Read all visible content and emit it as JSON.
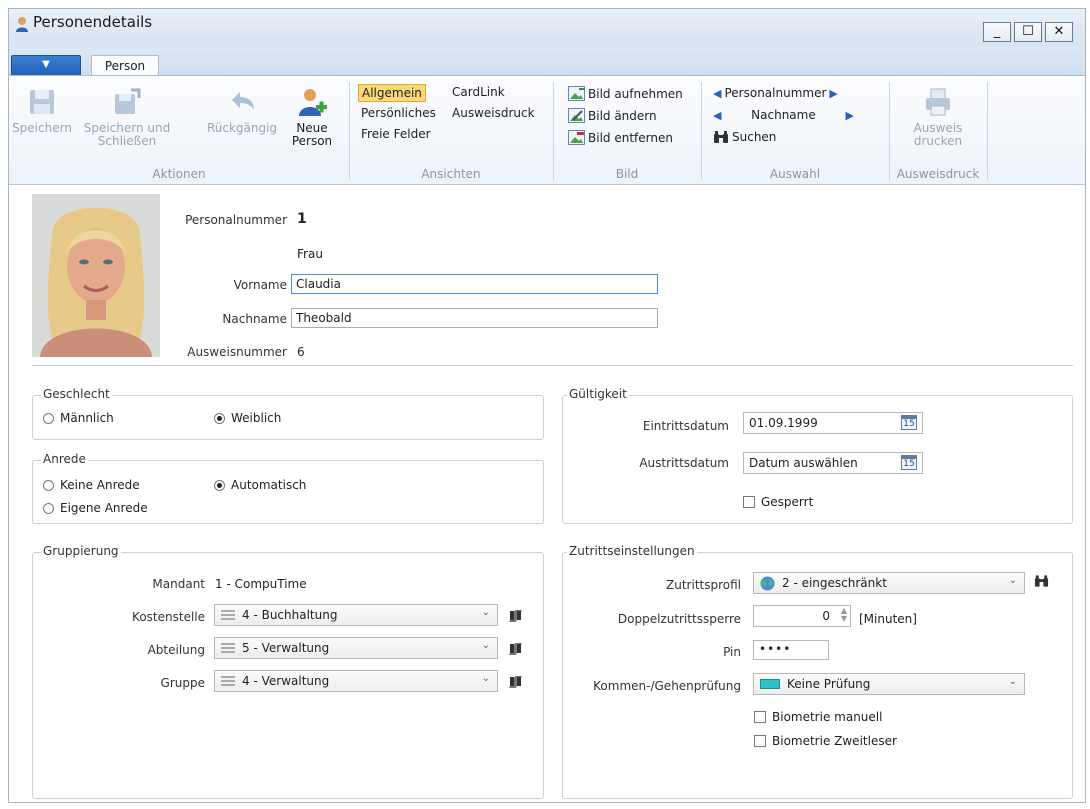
{
  "window": {
    "title": "Personendetails"
  },
  "tabs": {
    "app_menu": "▼",
    "person": "Person"
  },
  "ribbon": {
    "aktionen": {
      "label": "Aktionen",
      "save": "Speichern",
      "save_close_1": "Speichern und",
      "save_close_2": "Schließen",
      "undo": "Rückgängig",
      "new_person_1": "Neue",
      "new_person_2": "Person"
    },
    "ansichten": {
      "label": "Ansichten",
      "allgemein": "Allgemein",
      "cardlink": "CardLink",
      "persoenliches": "Persönliches",
      "ausweisdruck": "Ausweisdruck",
      "freie_felder": "Freie Felder"
    },
    "bild": {
      "label": "Bild",
      "aufnehmen": "Bild aufnehmen",
      "aendern": "Bild ändern",
      "entfernen": "Bild entfernen"
    },
    "auswahl": {
      "label": "Auswahl",
      "personalnummer": "Personalnummer",
      "nachname": "Nachname",
      "suchen": "Suchen"
    },
    "ausweisdruck_group": {
      "label": "Ausweisdruck",
      "print_1": "Ausweis",
      "print_2": "drucken"
    }
  },
  "person": {
    "personalnummer_label": "Personalnummer",
    "personalnummer": "1",
    "anrede_display": "Frau",
    "vorname_label": "Vorname",
    "vorname": "Claudia",
    "nachname_label": "Nachname",
    "nachname": "Theobald",
    "ausweisnummer_label": "Ausweisnummer",
    "ausweisnummer": "6"
  },
  "geschlecht": {
    "title": "Geschlecht",
    "maennlich": "Männlich",
    "weiblich": "Weiblich",
    "selected": "weiblich"
  },
  "anrede": {
    "title": "Anrede",
    "keine": "Keine Anrede",
    "automatisch": "Automatisch",
    "eigene": "Eigene Anrede",
    "selected": "automatisch"
  },
  "gueltigkeit": {
    "title": "Gültigkeit",
    "eintritt_label": "Eintrittsdatum",
    "eintritt": "01.09.1999",
    "austritt_label": "Austrittsdatum",
    "austritt": "Datum auswählen",
    "calendar_day": "15",
    "gesperrt": "Gesperrt"
  },
  "gruppierung": {
    "title": "Gruppierung",
    "mandant_label": "Mandant",
    "mandant": "1 - CompuTime",
    "kostenstelle_label": "Kostenstelle",
    "kostenstelle": "4 - Buchhaltung",
    "abteilung_label": "Abteilung",
    "abteilung": "5 - Verwaltung",
    "gruppe_label": "Gruppe",
    "gruppe": "4 - Verwaltung"
  },
  "zutritt": {
    "title": "Zutrittseinstellungen",
    "profil_label": "Zutrittsprofil",
    "profil": "2 - eingeschränkt",
    "doppel_label": "Doppelzutrittssperre",
    "doppel_value": "0",
    "doppel_unit": "[Minuten]",
    "pin_label": "Pin",
    "pin": "••••",
    "kommen_label": "Kommen-/Gehenprüfung",
    "kommen": "Keine Prüfung",
    "bio_manuell": "Biometrie manuell",
    "bio_zweitleser": "Biometrie Zweitleser"
  }
}
